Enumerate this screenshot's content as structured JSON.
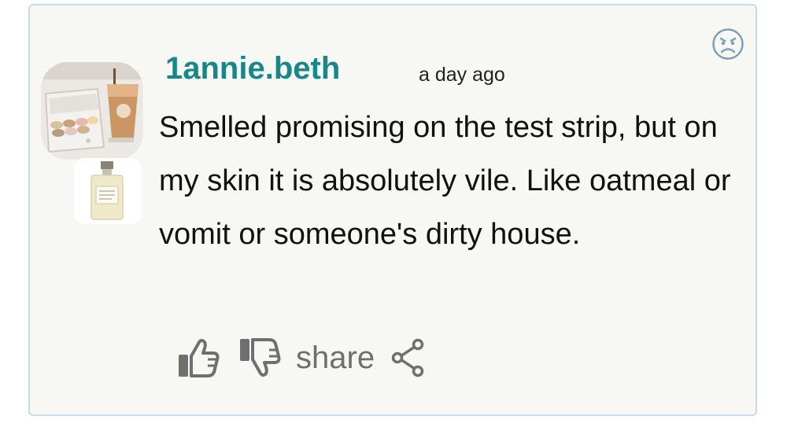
{
  "review": {
    "username": "1annie.beth",
    "timestamp": "a day ago",
    "text": "Smelled promising on the test strip, but on my skin it is absolutely vile. Like oatmeal or vomit or someone's dirty house.",
    "mood_icon": "sad-face-icon",
    "avatar_image": "macarons-and-iced-coffee",
    "product_thumbnail": "perfume-bottle"
  },
  "actions": {
    "like_icon": "thumbs-up-icon",
    "dislike_icon": "thumbs-down-icon",
    "share_label": "share",
    "share_icon": "share-icon"
  },
  "colors": {
    "username": "#17888a",
    "card_background": "#f7f7f3",
    "card_border": "#c8dbe8",
    "action_gray": "#6f6f6f"
  }
}
